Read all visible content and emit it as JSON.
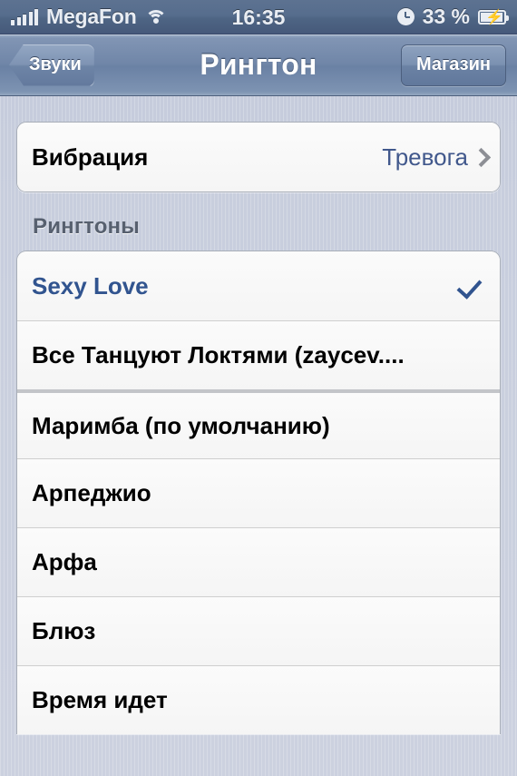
{
  "status_bar": {
    "carrier": "MegaFon",
    "signal_bars": 5,
    "wifi_icon": "wifi-icon",
    "time": "16:35",
    "alarm_icon": "clock-icon",
    "battery_percent": "33 %",
    "battery_icon": "battery-charging-icon"
  },
  "nav_bar": {
    "back_label": "Звуки",
    "title": "Рингтон",
    "right_label": "Магазин"
  },
  "vibration": {
    "label": "Вибрация",
    "value": "Тревога",
    "chevron_icon": "chevron-right-icon"
  },
  "section": {
    "header": "Рингтоны"
  },
  "ringtones": [
    {
      "label": "Sexy Love",
      "selected": true,
      "group_break": false
    },
    {
      "label": "Все Танцуют Локтями (zaycev....",
      "selected": false,
      "group_break": false
    },
    {
      "label": "Маримба (по умолчанию)",
      "selected": false,
      "group_break": true
    },
    {
      "label": "Арпеджио",
      "selected": false,
      "group_break": false
    },
    {
      "label": "Арфа",
      "selected": false,
      "group_break": false
    },
    {
      "label": "Блюз",
      "selected": false,
      "group_break": false
    },
    {
      "label": "Время идет",
      "selected": false,
      "group_break": false
    }
  ],
  "colors": {
    "background": "#c9cfdd",
    "navbar_blue": "#7086a8",
    "statusbar_blue": "#4e6584",
    "selected_text": "#31548f",
    "value_text": "#41588c",
    "cell_background": "#f7f7f7",
    "section_header_text": "#57606f"
  }
}
